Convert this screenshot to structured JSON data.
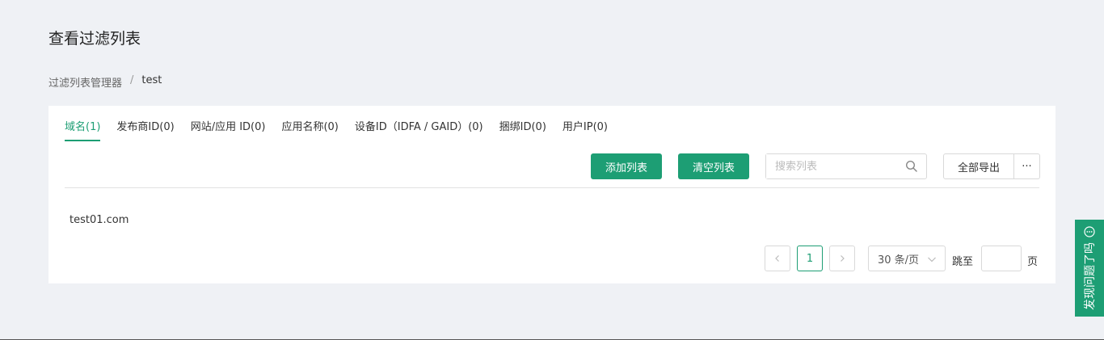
{
  "page": {
    "title": "查看过滤列表"
  },
  "breadcrumb": {
    "parent": "过滤列表管理器",
    "separator": "/",
    "current": "test"
  },
  "tabs": [
    {
      "label": "域名(1)",
      "active": true
    },
    {
      "label": "发布商ID(0)"
    },
    {
      "label": "网站/应用 ID(0)"
    },
    {
      "label": "应用名称(0)"
    },
    {
      "label": "设备ID（IDFA / GAID）(0)"
    },
    {
      "label": "捆绑ID(0)"
    },
    {
      "label": "用户IP(0)"
    }
  ],
  "toolbar": {
    "add_label": "添加列表",
    "clear_label": "清空列表",
    "search_placeholder": "搜索列表",
    "export_label": "全部导出",
    "more_label": "···"
  },
  "list": {
    "items": [
      "test01.com"
    ]
  },
  "pagination": {
    "current_page": "1",
    "page_size": "30 条/页",
    "jump_label": "跳至",
    "page_unit": "页"
  },
  "feedback": {
    "label": "发现问题了吗"
  },
  "colors": {
    "accent": "#1d9e74",
    "background": "#eff1f5"
  }
}
